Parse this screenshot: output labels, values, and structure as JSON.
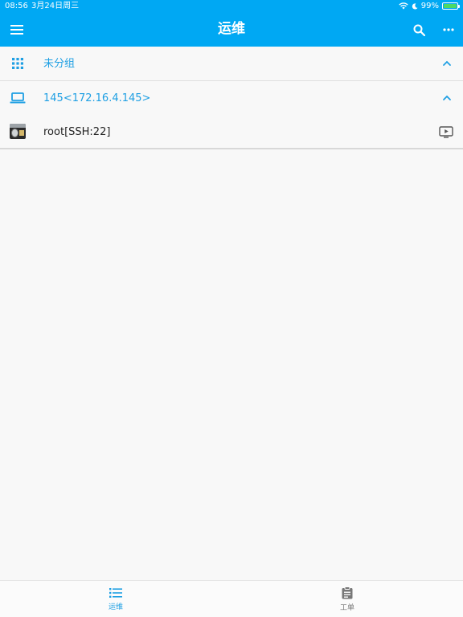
{
  "status_bar": {
    "time": "08:56",
    "date": "3月24日周三",
    "battery": "99%",
    "battery_level": 0.99
  },
  "app_bar": {
    "title": "运维",
    "menu_icon": "menu-icon",
    "search_icon": "search-icon",
    "more_icon": "more-horizontal-icon",
    "color": "#00a8f3"
  },
  "list": {
    "group": {
      "label": "未分组",
      "icon": "grid-icon",
      "expanded": true
    },
    "host": {
      "label": "145<172.16.4.145>",
      "icon": "laptop-icon",
      "expanded": true
    },
    "account": {
      "label": "root[SSH:22]",
      "icon": "terminal-app-icon",
      "action_icon": "launch-screen-icon"
    }
  },
  "tabbar": {
    "tabs": [
      {
        "label": "运维",
        "icon": "list-icon",
        "active": true
      },
      {
        "label": "工单",
        "icon": "clipboard-icon",
        "active": false
      }
    ],
    "accent": "#1e9fe3"
  }
}
